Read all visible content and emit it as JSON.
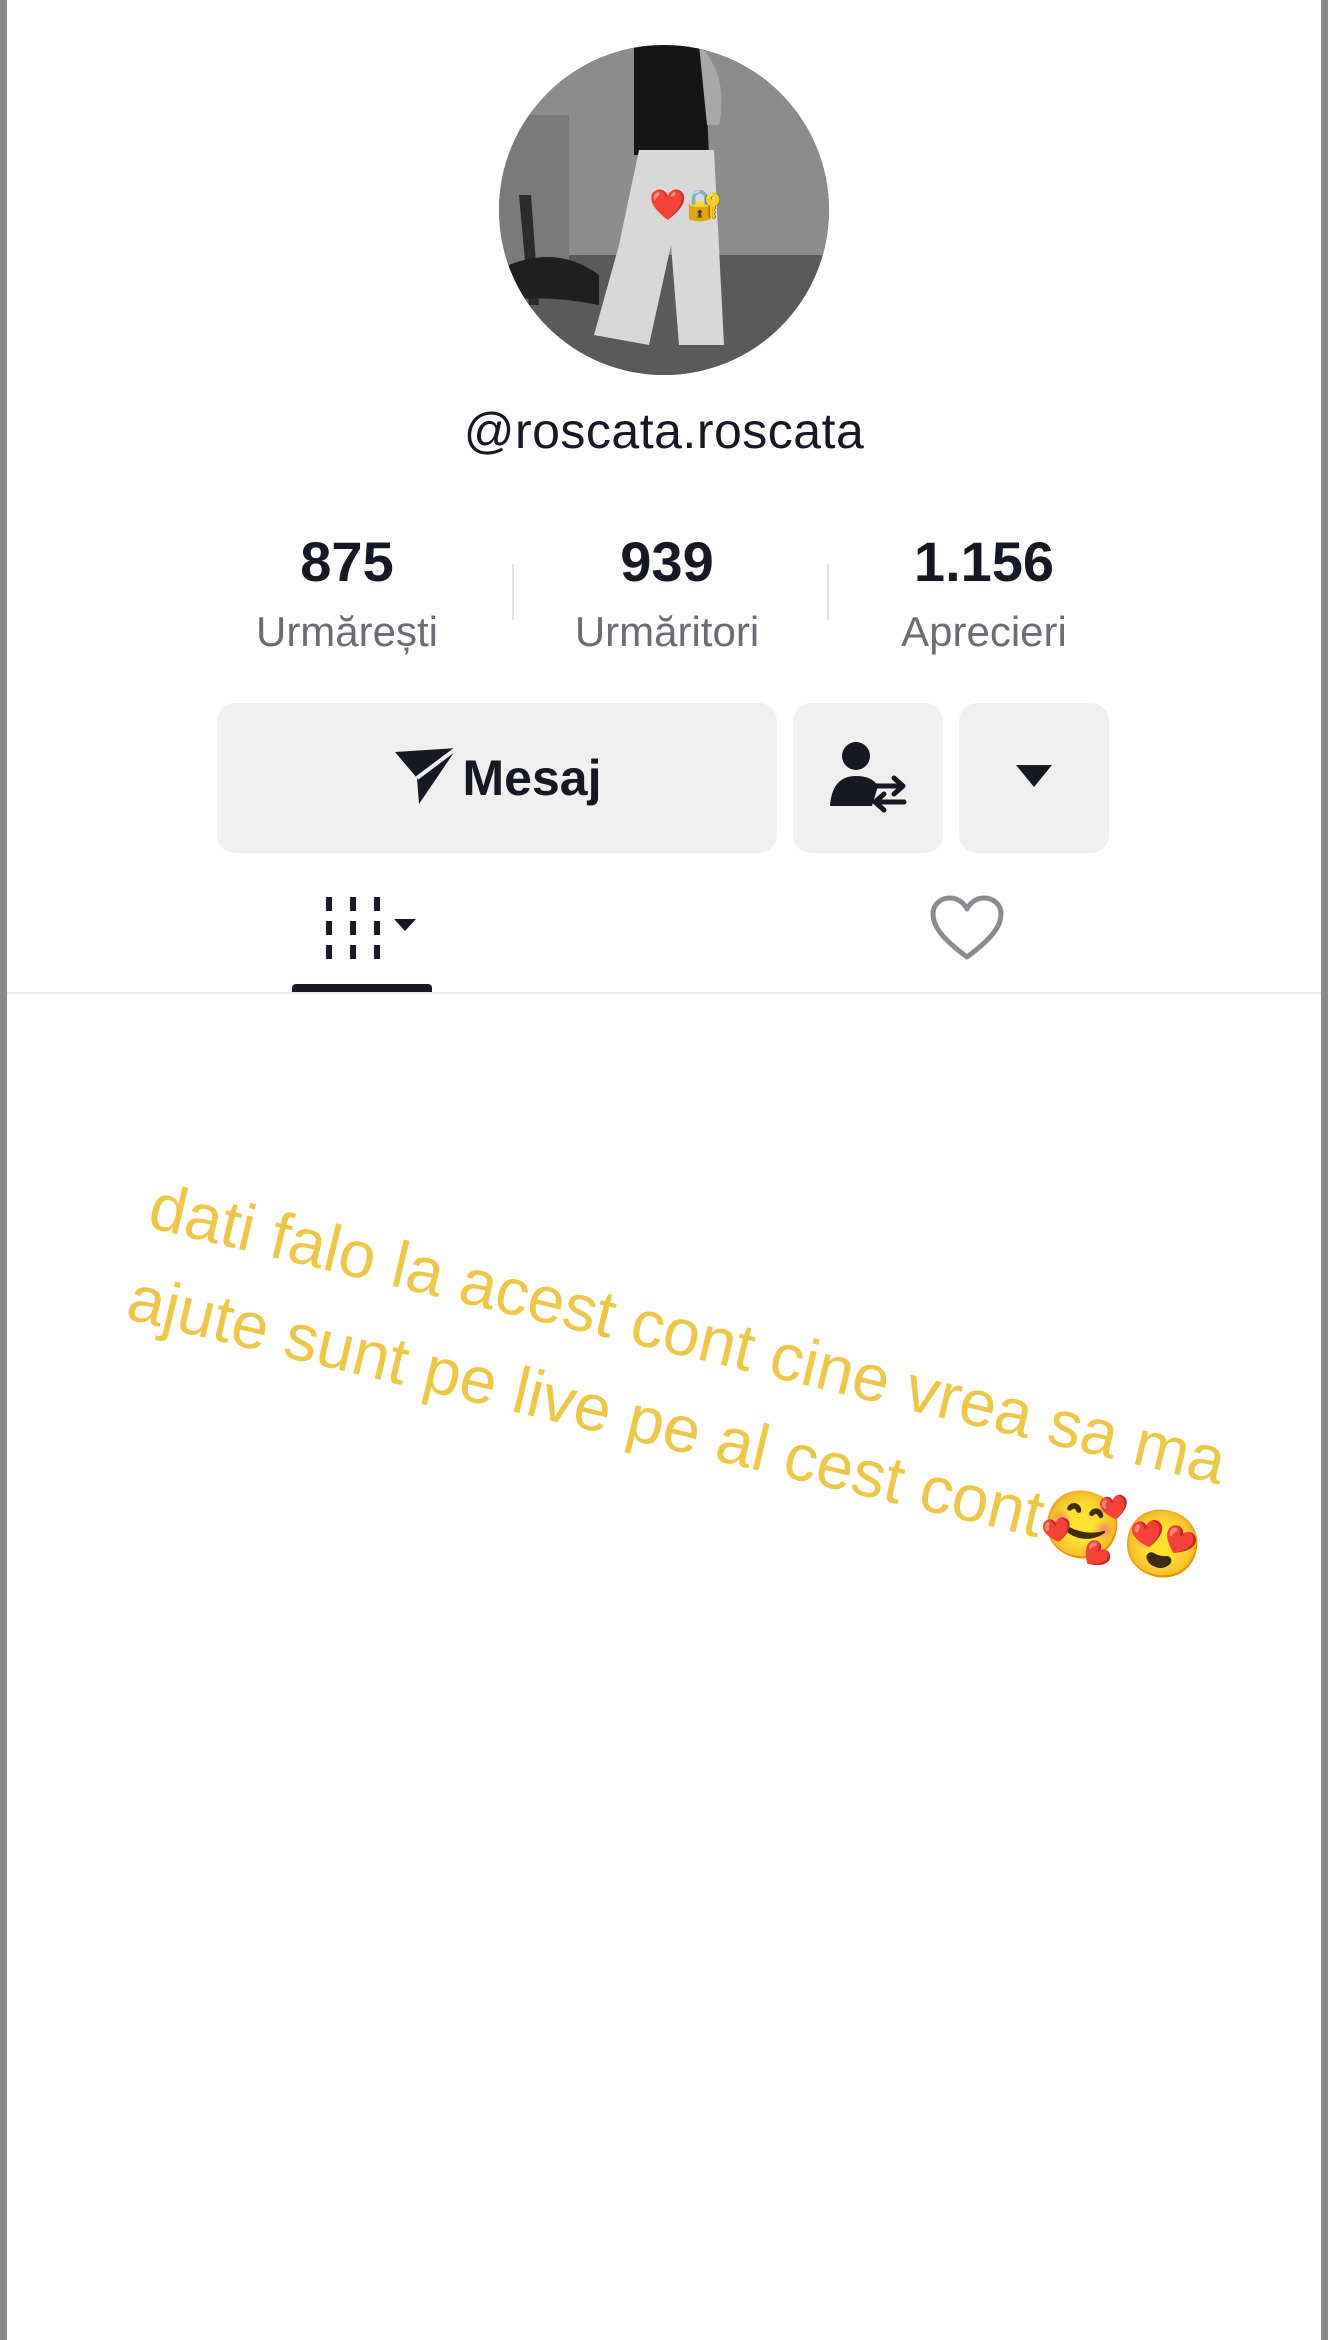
{
  "profile": {
    "username": "@roscata.roscata",
    "avatar_badge": "❤️🔐"
  },
  "stats": [
    {
      "value": "875",
      "label": "Urmărești"
    },
    {
      "value": "939",
      "label": "Urmăritori"
    },
    {
      "value": "1.156",
      "label": "Aprecieri"
    }
  ],
  "actions": {
    "message_label": "Mesaj",
    "message_icon": "send-icon",
    "follow_icon": "user-swap-icon",
    "more_icon": "caret-down-icon"
  },
  "tabs": [
    {
      "name": "videos",
      "icon": "grid-icon",
      "active": true
    },
    {
      "name": "liked",
      "icon": "heart-outline-icon",
      "active": false
    }
  ],
  "overlay": {
    "text": "dati falo la acest cont cine vrea sa ma  ajute sunt pe live pe al cest cont🥰😍",
    "color": "#edc74a"
  }
}
